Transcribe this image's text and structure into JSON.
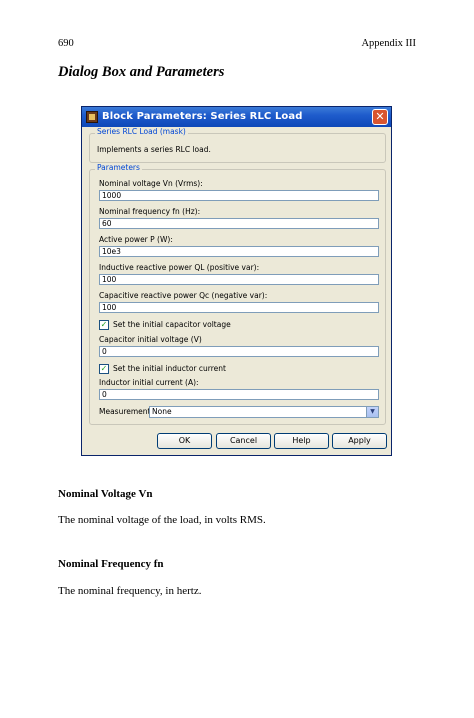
{
  "page": {
    "number": "690",
    "running_head": "Appendix III",
    "section_title": "Dialog Box and Parameters"
  },
  "dialog": {
    "title": "Block Parameters: Series RLC Load",
    "close_glyph": "✕",
    "mask_group": {
      "legend": "Series RLC Load (mask)",
      "description": "Implements a series RLC load."
    },
    "params_group": {
      "legend": "Parameters",
      "fields": [
        {
          "label": "Nominal voltage Vn (Vrms):",
          "value": "1000"
        },
        {
          "label": "Nominal frequency fn (Hz):",
          "value": "60"
        },
        {
          "label": "Active power P (W):",
          "value": "10e3"
        },
        {
          "label": "Inductive reactive power QL (positive var):",
          "value": "100"
        },
        {
          "label": "Capacitive reactive power Qc (negative var):",
          "value": "100"
        }
      ],
      "cap_checkbox": {
        "label": "Set the initial capacitor voltage",
        "checked": true,
        "mark": "✓"
      },
      "cap_voltage": {
        "label": "Capacitor initial voltage (V)",
        "value": "0"
      },
      "ind_checkbox": {
        "label": "Set the initial inductor current",
        "checked": true,
        "mark": "✓"
      },
      "ind_current": {
        "label": "Inductor initial current (A):",
        "value": "0"
      },
      "measurements": {
        "label": "Measurements",
        "value": "None",
        "arrow": "▼"
      }
    },
    "buttons": {
      "ok": "OK",
      "cancel": "Cancel",
      "help": "Help",
      "apply": "Apply"
    },
    "colors": {
      "titlebar": "#0d47b8",
      "window": "#ece9d8",
      "legend": "#0046d5"
    }
  },
  "body": {
    "h1": "Nominal Voltage Vn",
    "p1": "The nominal voltage of the load, in volts RMS.",
    "h2": "Nominal Frequency fn",
    "p2": "The nominal frequency, in hertz."
  }
}
